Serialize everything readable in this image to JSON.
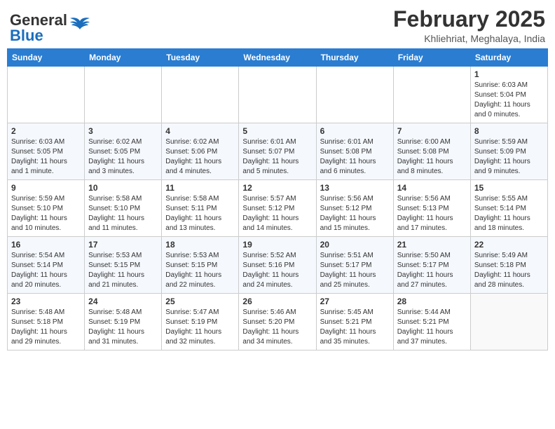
{
  "header": {
    "logo_general": "General",
    "logo_blue": "Blue",
    "month_title": "February 2025",
    "location": "Khliehriat, Meghalaya, India"
  },
  "weekdays": [
    "Sunday",
    "Monday",
    "Tuesday",
    "Wednesday",
    "Thursday",
    "Friday",
    "Saturday"
  ],
  "weeks": [
    [
      {
        "day": "",
        "info": ""
      },
      {
        "day": "",
        "info": ""
      },
      {
        "day": "",
        "info": ""
      },
      {
        "day": "",
        "info": ""
      },
      {
        "day": "",
        "info": ""
      },
      {
        "day": "",
        "info": ""
      },
      {
        "day": "1",
        "info": "Sunrise: 6:03 AM\nSunset: 5:04 PM\nDaylight: 11 hours\nand 0 minutes."
      }
    ],
    [
      {
        "day": "2",
        "info": "Sunrise: 6:03 AM\nSunset: 5:05 PM\nDaylight: 11 hours\nand 1 minute."
      },
      {
        "day": "3",
        "info": "Sunrise: 6:02 AM\nSunset: 5:05 PM\nDaylight: 11 hours\nand 3 minutes."
      },
      {
        "day": "4",
        "info": "Sunrise: 6:02 AM\nSunset: 5:06 PM\nDaylight: 11 hours\nand 4 minutes."
      },
      {
        "day": "5",
        "info": "Sunrise: 6:01 AM\nSunset: 5:07 PM\nDaylight: 11 hours\nand 5 minutes."
      },
      {
        "day": "6",
        "info": "Sunrise: 6:01 AM\nSunset: 5:08 PM\nDaylight: 11 hours\nand 6 minutes."
      },
      {
        "day": "7",
        "info": "Sunrise: 6:00 AM\nSunset: 5:08 PM\nDaylight: 11 hours\nand 8 minutes."
      },
      {
        "day": "8",
        "info": "Sunrise: 5:59 AM\nSunset: 5:09 PM\nDaylight: 11 hours\nand 9 minutes."
      }
    ],
    [
      {
        "day": "9",
        "info": "Sunrise: 5:59 AM\nSunset: 5:10 PM\nDaylight: 11 hours\nand 10 minutes."
      },
      {
        "day": "10",
        "info": "Sunrise: 5:58 AM\nSunset: 5:10 PM\nDaylight: 11 hours\nand 11 minutes."
      },
      {
        "day": "11",
        "info": "Sunrise: 5:58 AM\nSunset: 5:11 PM\nDaylight: 11 hours\nand 13 minutes."
      },
      {
        "day": "12",
        "info": "Sunrise: 5:57 AM\nSunset: 5:12 PM\nDaylight: 11 hours\nand 14 minutes."
      },
      {
        "day": "13",
        "info": "Sunrise: 5:56 AM\nSunset: 5:12 PM\nDaylight: 11 hours\nand 15 minutes."
      },
      {
        "day": "14",
        "info": "Sunrise: 5:56 AM\nSunset: 5:13 PM\nDaylight: 11 hours\nand 17 minutes."
      },
      {
        "day": "15",
        "info": "Sunrise: 5:55 AM\nSunset: 5:14 PM\nDaylight: 11 hours\nand 18 minutes."
      }
    ],
    [
      {
        "day": "16",
        "info": "Sunrise: 5:54 AM\nSunset: 5:14 PM\nDaylight: 11 hours\nand 20 minutes."
      },
      {
        "day": "17",
        "info": "Sunrise: 5:53 AM\nSunset: 5:15 PM\nDaylight: 11 hours\nand 21 minutes."
      },
      {
        "day": "18",
        "info": "Sunrise: 5:53 AM\nSunset: 5:15 PM\nDaylight: 11 hours\nand 22 minutes."
      },
      {
        "day": "19",
        "info": "Sunrise: 5:52 AM\nSunset: 5:16 PM\nDaylight: 11 hours\nand 24 minutes."
      },
      {
        "day": "20",
        "info": "Sunrise: 5:51 AM\nSunset: 5:17 PM\nDaylight: 11 hours\nand 25 minutes."
      },
      {
        "day": "21",
        "info": "Sunrise: 5:50 AM\nSunset: 5:17 PM\nDaylight: 11 hours\nand 27 minutes."
      },
      {
        "day": "22",
        "info": "Sunrise: 5:49 AM\nSunset: 5:18 PM\nDaylight: 11 hours\nand 28 minutes."
      }
    ],
    [
      {
        "day": "23",
        "info": "Sunrise: 5:48 AM\nSunset: 5:18 PM\nDaylight: 11 hours\nand 29 minutes."
      },
      {
        "day": "24",
        "info": "Sunrise: 5:48 AM\nSunset: 5:19 PM\nDaylight: 11 hours\nand 31 minutes."
      },
      {
        "day": "25",
        "info": "Sunrise: 5:47 AM\nSunset: 5:19 PM\nDaylight: 11 hours\nand 32 minutes."
      },
      {
        "day": "26",
        "info": "Sunrise: 5:46 AM\nSunset: 5:20 PM\nDaylight: 11 hours\nand 34 minutes."
      },
      {
        "day": "27",
        "info": "Sunrise: 5:45 AM\nSunset: 5:21 PM\nDaylight: 11 hours\nand 35 minutes."
      },
      {
        "day": "28",
        "info": "Sunrise: 5:44 AM\nSunset: 5:21 PM\nDaylight: 11 hours\nand 37 minutes."
      },
      {
        "day": "",
        "info": ""
      }
    ]
  ]
}
